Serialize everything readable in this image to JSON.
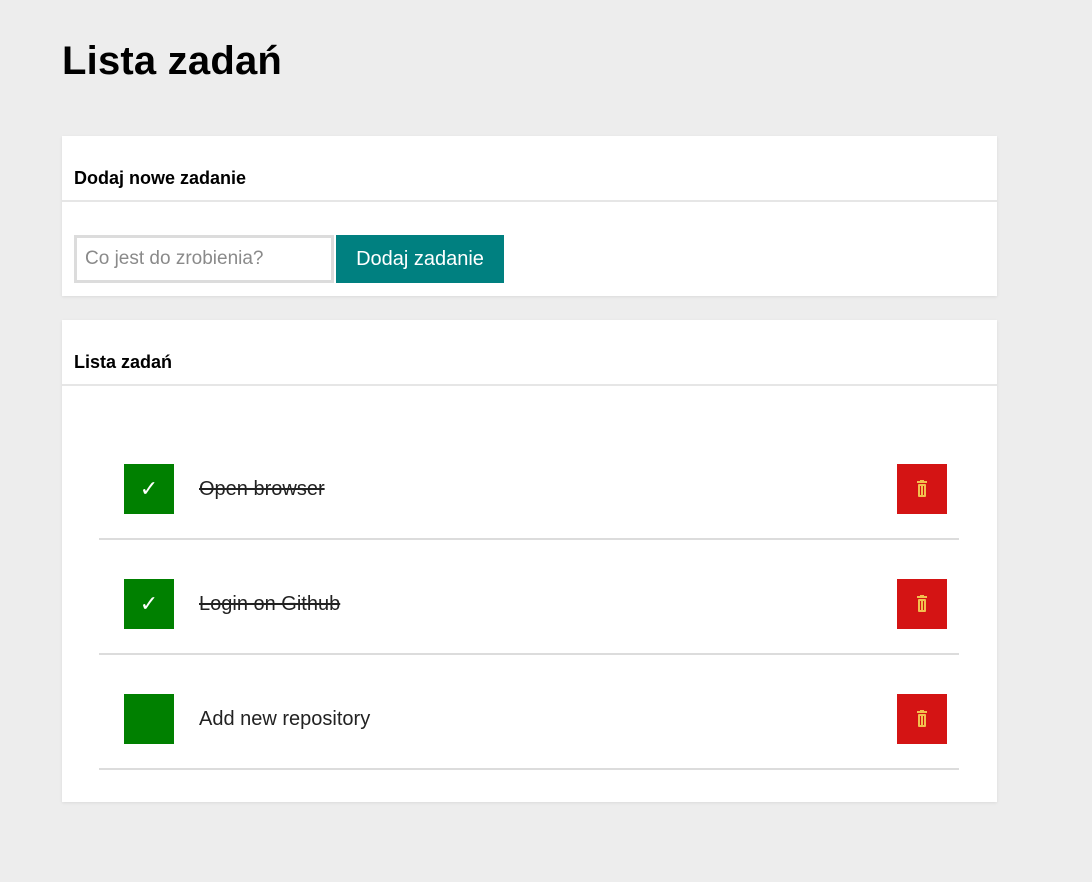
{
  "page": {
    "title": "Lista zadań"
  },
  "add_card": {
    "title": "Dodaj nowe zadanie",
    "input_value": "",
    "input_placeholder": "Co jest do zrobienia?",
    "button_label": "Dodaj zadanie"
  },
  "list_card": {
    "title": "Lista zadań",
    "tasks": [
      {
        "text": "Open browser",
        "done": true,
        "check_glyph": "✓",
        "icon": "trash-icon"
      },
      {
        "text": "Login on Github",
        "done": true,
        "check_glyph": "✓",
        "icon": "trash-icon"
      },
      {
        "text": "Add new repository",
        "done": false,
        "check_glyph": "",
        "icon": "trash-icon"
      }
    ]
  },
  "colors": {
    "background": "#ededed",
    "accent_teal": "#008080",
    "check_green": "#008000",
    "delete_red": "#d41414",
    "trash_icon": "#f2c04e"
  }
}
